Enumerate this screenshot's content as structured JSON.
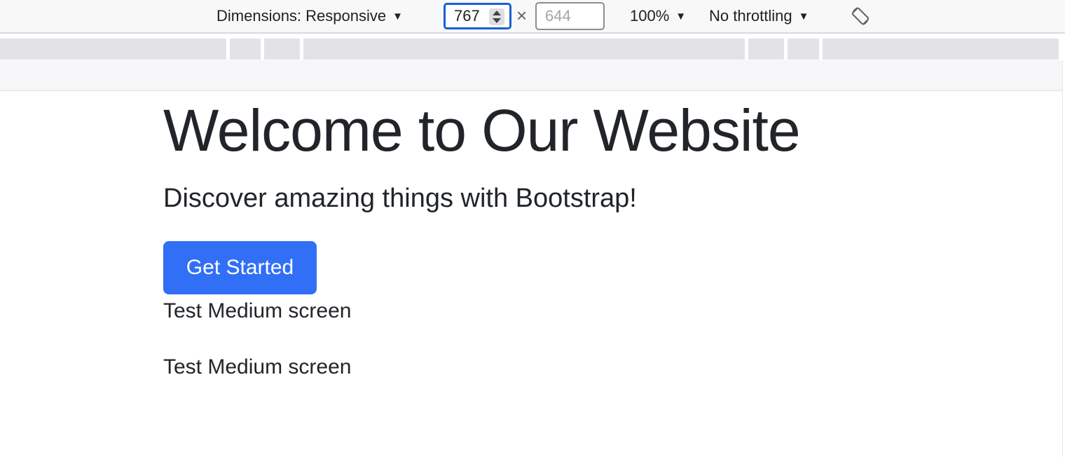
{
  "devtools_toolbar": {
    "dimensions_label": "Dimensions: Responsive",
    "width_value": "767",
    "times_symbol": "×",
    "height_placeholder": "644",
    "zoom_label": "100%",
    "throttle_label": "No throttling",
    "caret_glyph": "▼",
    "rotate_icon": "rotate-icon"
  },
  "page": {
    "hero_title": "Welcome to Our Website",
    "hero_lead": "Discover amazing things with Bootstrap!",
    "cta_label": "Get Started",
    "test_lines": [
      "Test Medium screen",
      "Test Medium screen"
    ]
  },
  "colors": {
    "primary": "#316ff6",
    "focus_border": "#1a5fd0",
    "text": "#212529"
  }
}
